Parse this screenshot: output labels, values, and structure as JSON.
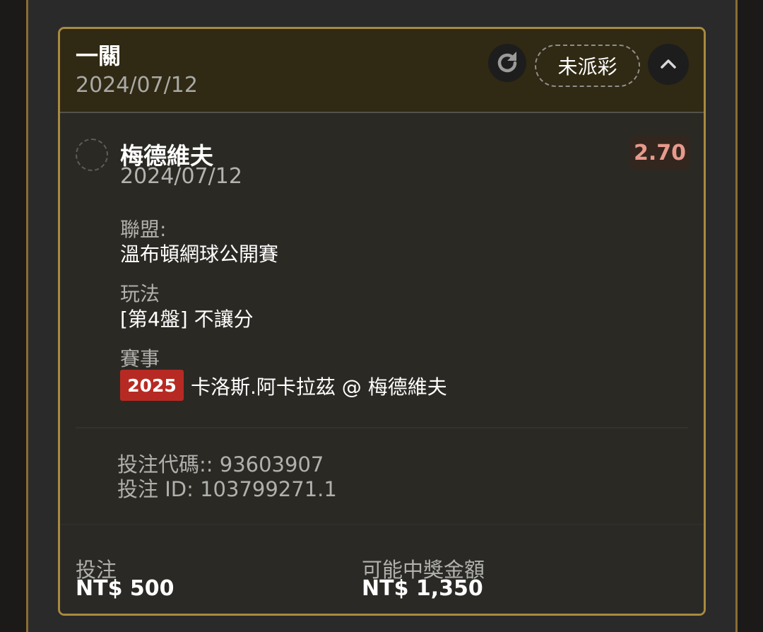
{
  "header": {
    "bet_type": "一關",
    "date": "2024/07/12",
    "status": "未派彩"
  },
  "selection": {
    "name": "梅德維夫",
    "date": "2024/07/12",
    "odds": "2.70"
  },
  "details": {
    "league_label": "聯盟:",
    "league_value": "溫布頓網球公開賽",
    "market_label": "玩法",
    "market_value": "[第4盤] 不讓分",
    "event_label": "賽事",
    "event_year": "2025",
    "event_match": "卡洛斯.阿卡拉茲 @ 梅德維夫"
  },
  "meta": {
    "bet_code": "投注代碼:: 93603907",
    "bet_id": "投注 ID: 103799271.1"
  },
  "footer": {
    "stake_label": "投注",
    "stake_value": "NT$ 500",
    "payout_label": "可能中獎金額",
    "payout_value": "NT$ 1,350"
  },
  "colors": {
    "card_border": "#a88a3e",
    "header_bg": "#302913",
    "odds_text": "#e79a8c",
    "year_badge": "#b72a23"
  },
  "icons": {
    "refresh": "refresh-icon",
    "collapse": "chevron-up-icon"
  }
}
